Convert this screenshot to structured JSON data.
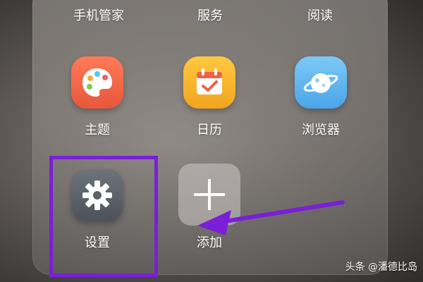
{
  "folder": {
    "top_labels": [
      "手机管家",
      "服务",
      "阅读"
    ],
    "apps": [
      {
        "label": "主题",
        "icon": "theme-palette-icon",
        "color": "#f06a4c"
      },
      {
        "label": "日历",
        "icon": "calendar-icon",
        "color": "#f6b52c"
      },
      {
        "label": "浏览器",
        "icon": "browser-planet-icon",
        "color": "#5fb6ef"
      },
      {
        "label": "设置",
        "icon": "gear-icon",
        "color": "#5b6268"
      },
      {
        "label": "添加",
        "icon": "add-plus-icon",
        "color": "#b9b6b3"
      }
    ]
  },
  "annotation": {
    "color": "#7a1fd6"
  },
  "watermark": {
    "text": "头条 @潘德比岛"
  }
}
